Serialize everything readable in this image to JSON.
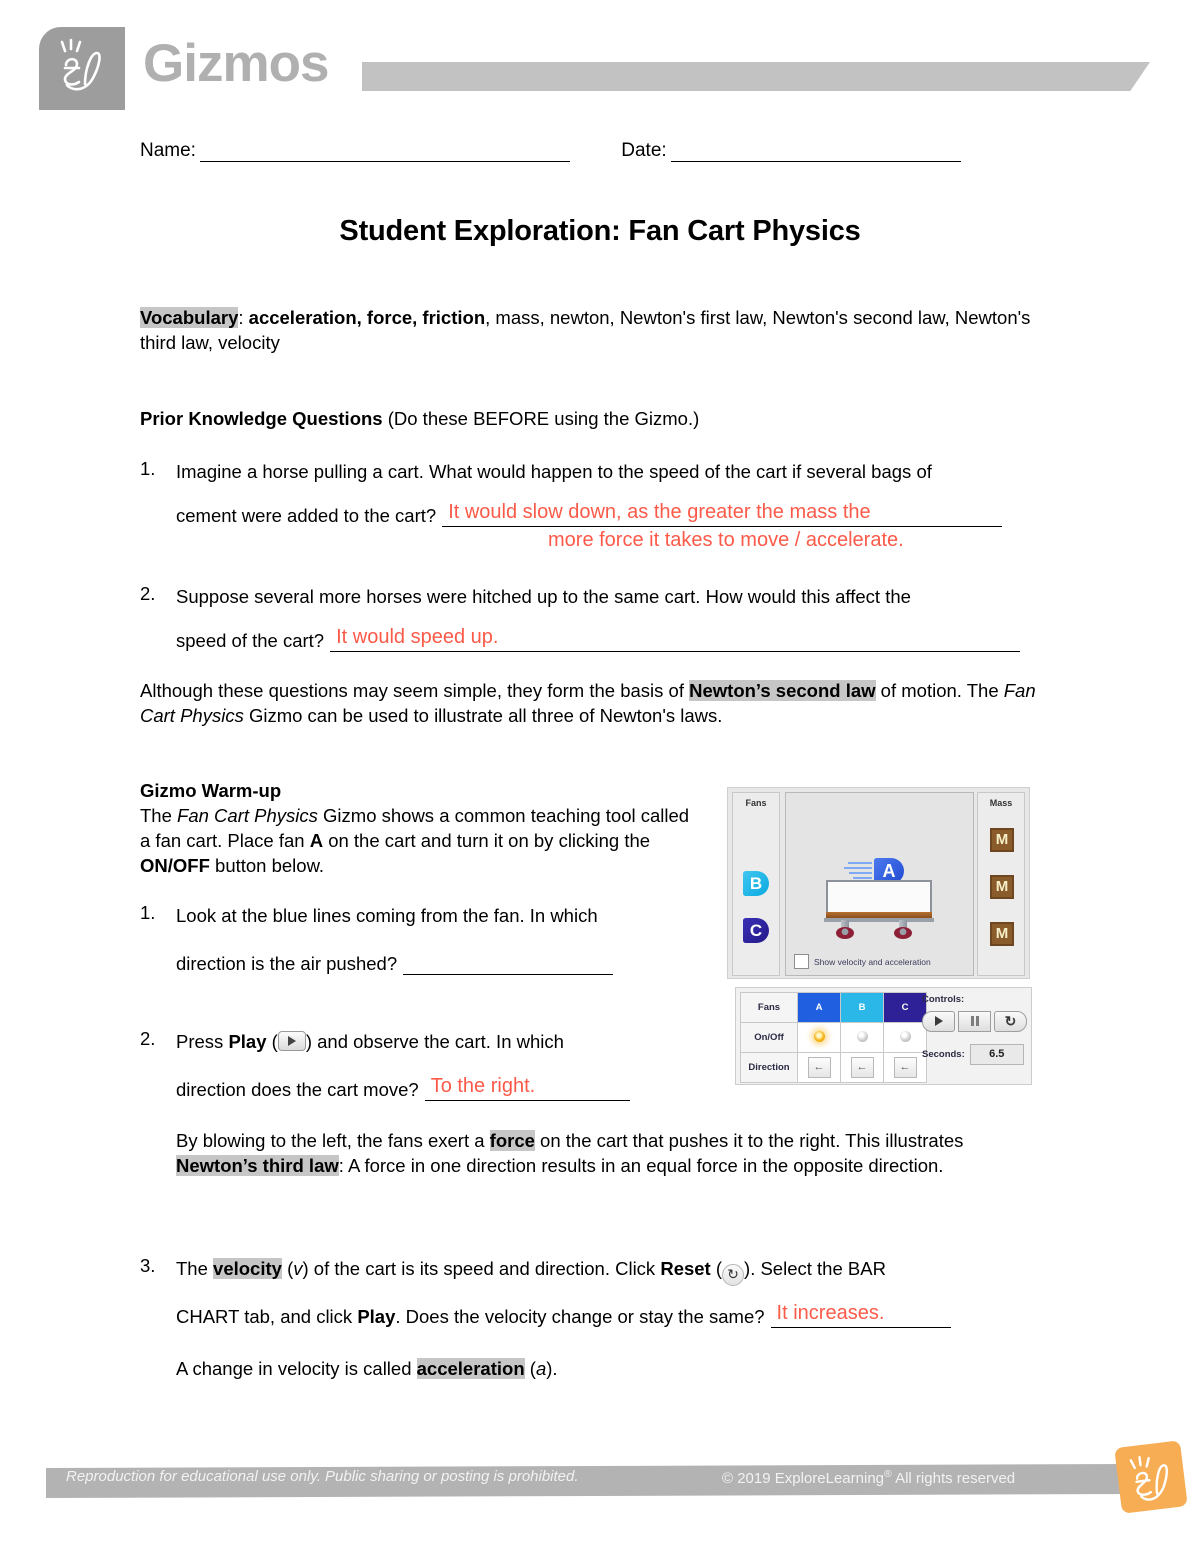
{
  "header": {
    "brand": "Gizmos",
    "logo_alt": "el-logo-icon"
  },
  "fields": {
    "name_label": "Name:",
    "date_label": "Date:"
  },
  "title": "Student Exploration: Fan Cart Physics",
  "vocabulary": {
    "label": "Vocabulary",
    "colon": ": ",
    "terms_bold": "acceleration, force, friction",
    "terms_rest": ", mass, newton, Newton's first law, Newton's second law, Newton's third law, velocity"
  },
  "prior_knowledge": {
    "heading_bold": "Prior Knowledge Questions",
    "heading_rest": " (Do these BEFORE using the Gizmo.)",
    "q1": {
      "num": "1.",
      "text_a": "Imagine a horse pulling a cart. What would happen to the speed of the cart if several bags of",
      "text_b": "cement were added to the cart?",
      "answer_line1": "It would slow down, as the greater the mass the",
      "answer_line2": "more force it takes to move / accelerate."
    },
    "q2": {
      "num": "2.",
      "text_a": "Suppose several more horses were hitched up to the same cart. How would this affect the",
      "text_b": "speed of the cart?",
      "answer_line1": "It would speed up."
    }
  },
  "basis_paragraph": {
    "part1": "Although these questions may seem simple, they form the basis of ",
    "highlight": "Newton’s second law",
    "part2": " of motion. The ",
    "italic": "Fan Cart Physics",
    "part3": " Gizmo can be used to illustrate all three of Newton's laws."
  },
  "warmup": {
    "heading": "Gizmo Warm-up",
    "text_part1": "The ",
    "text_italic": "Fan Cart Physics",
    "text_part2": " Gizmo shows a common teaching tool called a fan cart. Place fan ",
    "bold_a": "A",
    "text_part3": " on the cart and turn it on by clicking the ",
    "bold_onoff": "ON/OFF",
    "text_part4": " button below.",
    "q1": {
      "num": "1.",
      "text_a": "Look at the blue lines coming from the fan. In which",
      "text_b": "direction is the air pushed?",
      "answer": ""
    },
    "q2": {
      "num": "2.",
      "text_pre": "Press ",
      "bold_play": "Play",
      "text_paren_open": " (",
      "text_paren_close": ") and observe the cart. In which",
      "text_b": "direction does the cart move?",
      "answer": "To the right."
    },
    "blowing": {
      "part1": "By blowing to the left, the fans exert a ",
      "hl_force": "force",
      "part2": " on the cart that pushes it to the right. This illustrates ",
      "hl_law": "Newton’s third law",
      "part3": ": A force in one direction results in an equal force in the opposite direction."
    },
    "q3": {
      "num": "3.",
      "part1": "The ",
      "hl_velocity": "velocity",
      "part2": " (",
      "italic_v": "v",
      "part3": ") of the cart is its speed and direction. Click ",
      "bold_reset": "Reset",
      "part4": " (",
      "part5": "). Select the BAR",
      "line2_a": "CHART tab, and click ",
      "line2_bold_play": "Play",
      "line2_b": ". Does the velocity change or stay the same?",
      "answer": "It increases.",
      "line3_a": "A change in velocity is called ",
      "hl_accel": "acceleration",
      "line3_b": " (",
      "italic_a": "a",
      "line3_c": ")."
    }
  },
  "gizmo": {
    "fans_panel_label": "Fans",
    "mass_panel_label": "Mass",
    "fan_b": "B",
    "fan_c": "C",
    "fan_a": "A",
    "mass_blocks": [
      "M",
      "M",
      "M"
    ],
    "show_checkbox_label": "Show velocity and acceleration",
    "table": {
      "row_labels": [
        "Fans",
        "On/Off",
        "Direction"
      ],
      "columns": [
        "A",
        "B",
        "C"
      ],
      "onoff_states": [
        "on",
        "off",
        "off"
      ],
      "direction_glyphs": [
        "←",
        "←",
        "←"
      ]
    },
    "controls_label": "Controls:",
    "play_icon": "play-icon",
    "pause_icon": "pause-icon",
    "reset_icon": "reset-icon",
    "seconds_label": "Seconds:",
    "seconds_value": "6.5",
    "colors": {
      "fan_a": "#1f5fe0",
      "fan_b": "#2bb8e8",
      "fan_c": "#2e2197",
      "mass_block": "#8a5c2b",
      "led_on": "#f5b315"
    }
  },
  "footer": {
    "left_text": "Reproduction for educational use only. Public sharing or posting is prohibited.",
    "copyright_pre": "© 2019 ExploreLearning",
    "copyright_sup": "®",
    "copyright_post": " All rights reserved",
    "logo_alt": "el-logo-icon"
  }
}
